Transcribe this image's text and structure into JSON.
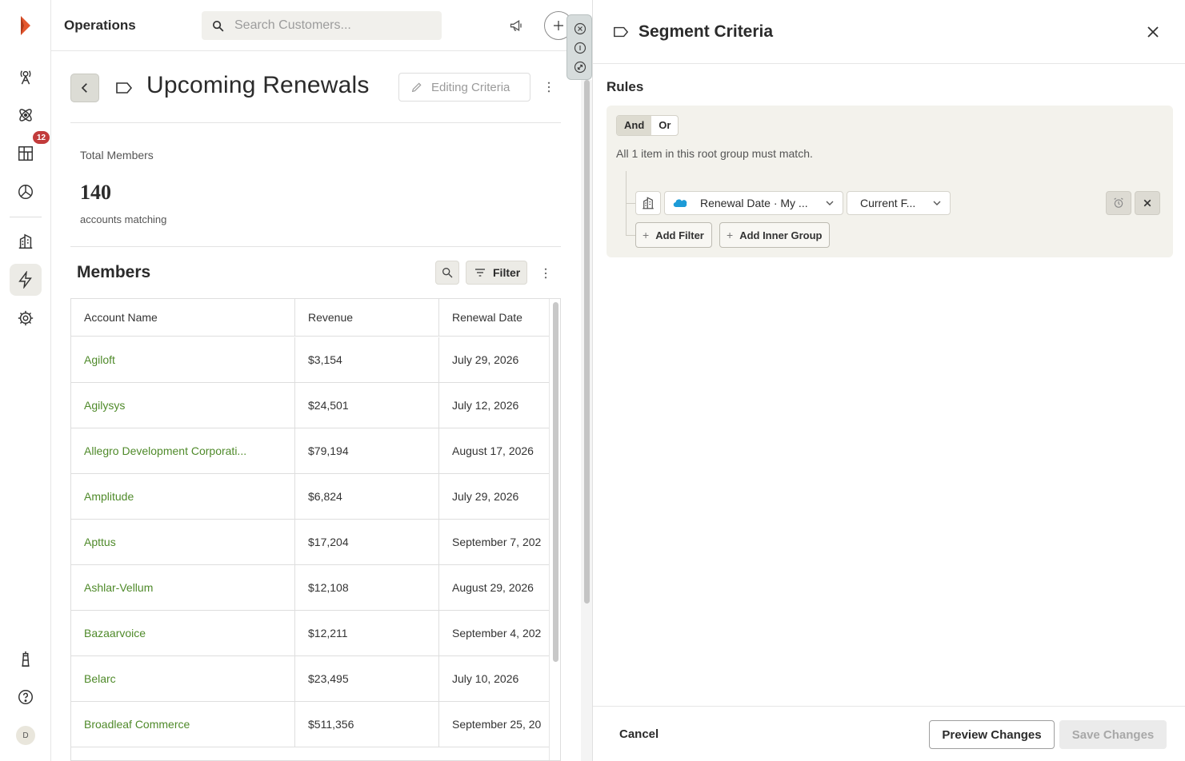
{
  "app": {
    "title": "Operations",
    "notification_count": "12",
    "user_initial": "D",
    "accent_color": "#4f8a2a",
    "logo_color": "#e4572e"
  },
  "search": {
    "placeholder": "Search Customers..."
  },
  "nav_icons": [
    "radar-icon",
    "atom-icon",
    "grid-icon",
    "pie-chart-icon",
    "buildings-icon",
    "lightning-icon",
    "gear-icon",
    "lighthouse-icon",
    "help-icon"
  ],
  "segment": {
    "title": "Upcoming Renewals",
    "edit_label": "Editing Criteria",
    "total_label": "Total Members",
    "total_value": "140",
    "total_sub": "accounts matching"
  },
  "members": {
    "title": "Members",
    "filter_label": "Filter",
    "columns": [
      "Account Name",
      "Revenue",
      "Renewal Date"
    ],
    "rows": [
      [
        "Agiloft",
        "$3,154",
        "July 29, 2026"
      ],
      [
        "Agilysys",
        "$24,501",
        "July 12, 2026"
      ],
      [
        "Allegro Development Corporati...",
        "$79,194",
        "August 17, 2026"
      ],
      [
        "Amplitude",
        "$6,824",
        "July 29, 2026"
      ],
      [
        "Apttus",
        "$17,204",
        "September 7, 202"
      ],
      [
        "Ashlar-Vellum",
        "$12,108",
        "August 29, 2026"
      ],
      [
        "Bazaarvoice",
        "$12,211",
        "September 4, 202"
      ],
      [
        "Belarc",
        "$23,495",
        "July 10, 2026"
      ],
      [
        "Broadleaf Commerce",
        "$511,356",
        "September 25, 20"
      ]
    ]
  },
  "panel": {
    "title": "Segment Criteria",
    "rules_label": "Rules",
    "and_label": "And",
    "or_label": "Or",
    "rules_desc": "All 1 item in this root group must match.",
    "filter_field": "Renewal Date · My ...",
    "filter_operator": "Current F...",
    "add_filter_label": "Add Filter",
    "add_group_label": "Add Inner Group",
    "cancel_label": "Cancel",
    "preview_label": "Preview Changes",
    "save_label": "Save Changes"
  }
}
